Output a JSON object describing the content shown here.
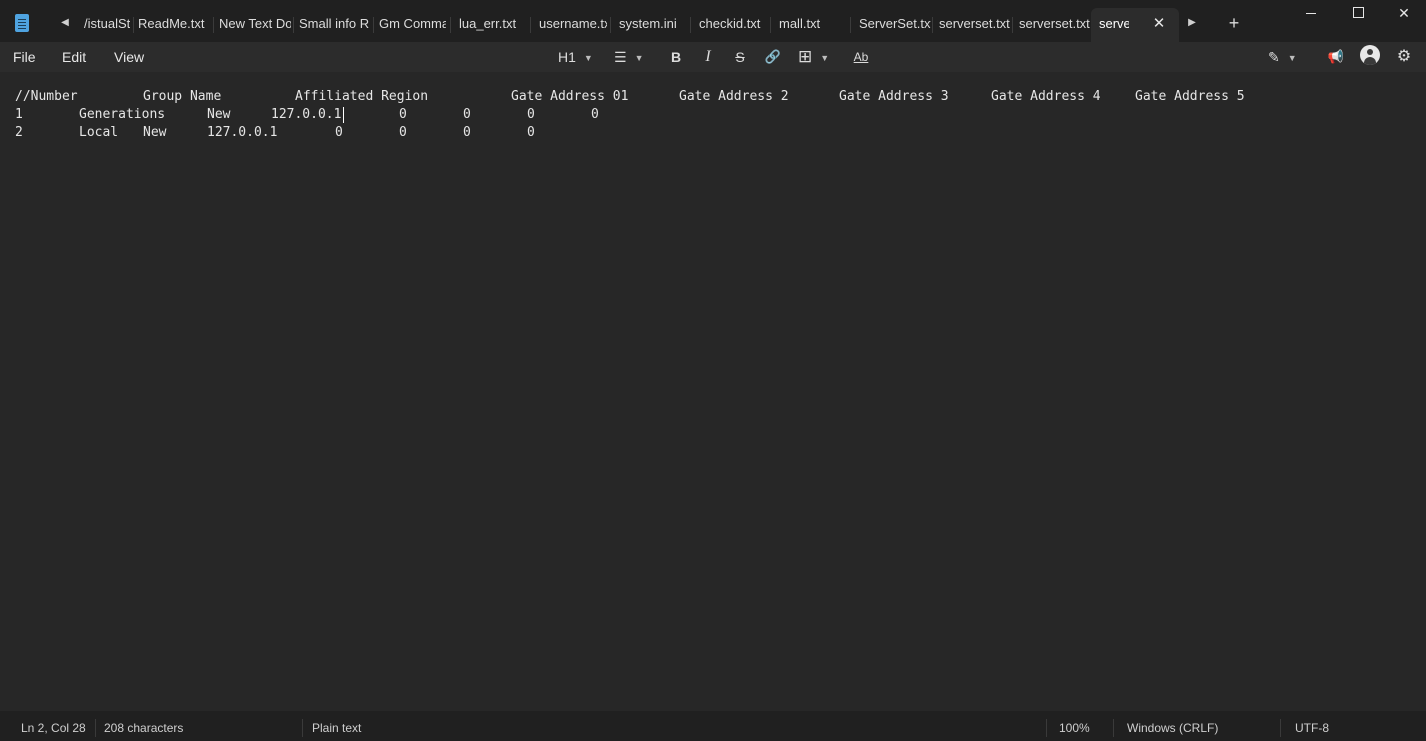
{
  "window": {
    "icon": "notepad-icon"
  },
  "tabs": [
    {
      "label": "/istualSt"
    },
    {
      "label": "ReadMe.txt"
    },
    {
      "label": "New Text Do"
    },
    {
      "label": "Small info RI"
    },
    {
      "label": "Gm Commai"
    },
    {
      "label": "lua_err.txt"
    },
    {
      "label": "username.tx"
    },
    {
      "label": "system.ini"
    },
    {
      "label": "checkid.txt"
    },
    {
      "label": "mall.txt"
    },
    {
      "label": "ServerSet.txt"
    },
    {
      "label": "serverset.txt"
    },
    {
      "label": "serverset.txt"
    },
    {
      "label": "server",
      "active": true
    }
  ],
  "tab_controls": {
    "scroll_left": "◀",
    "scroll_right": "▶",
    "new_tab": "+",
    "close_active": "✕"
  },
  "window_controls": {
    "close": "✕"
  },
  "menu": {
    "file": "File",
    "edit": "Edit",
    "view": "View"
  },
  "format_toolbar": {
    "heading": "H1",
    "list_icon": "☰",
    "bold": "B",
    "italic": "I",
    "strike": "S",
    "link_icon": "🔗",
    "table_icon": "⊞",
    "spell_icon": "Ab"
  },
  "right_toolbar": {
    "copilot_icon": "✎",
    "notifications_icon": "📢",
    "settings_icon": "⚙"
  },
  "document": {
    "lines": [
      [
        "//Number",
        "Group Name",
        "Affiliated Region",
        "Gate Address 01",
        "Gate Address 2",
        "Gate Address 3",
        "Gate Address 4",
        "Gate Address 5"
      ],
      [
        "1",
        "Generations",
        "New",
        "127.0.0.1",
        "0",
        "0",
        "0",
        "0"
      ],
      [
        "2",
        "Local",
        "New",
        "127.0.0.1",
        "0",
        "0",
        "0",
        "0"
      ]
    ]
  },
  "status": {
    "position": "Ln 2, Col 28",
    "characters": "208 characters",
    "format": "Plain text",
    "zoom": "100%",
    "line_ending": "Windows (CRLF)",
    "encoding": "UTF-8"
  }
}
